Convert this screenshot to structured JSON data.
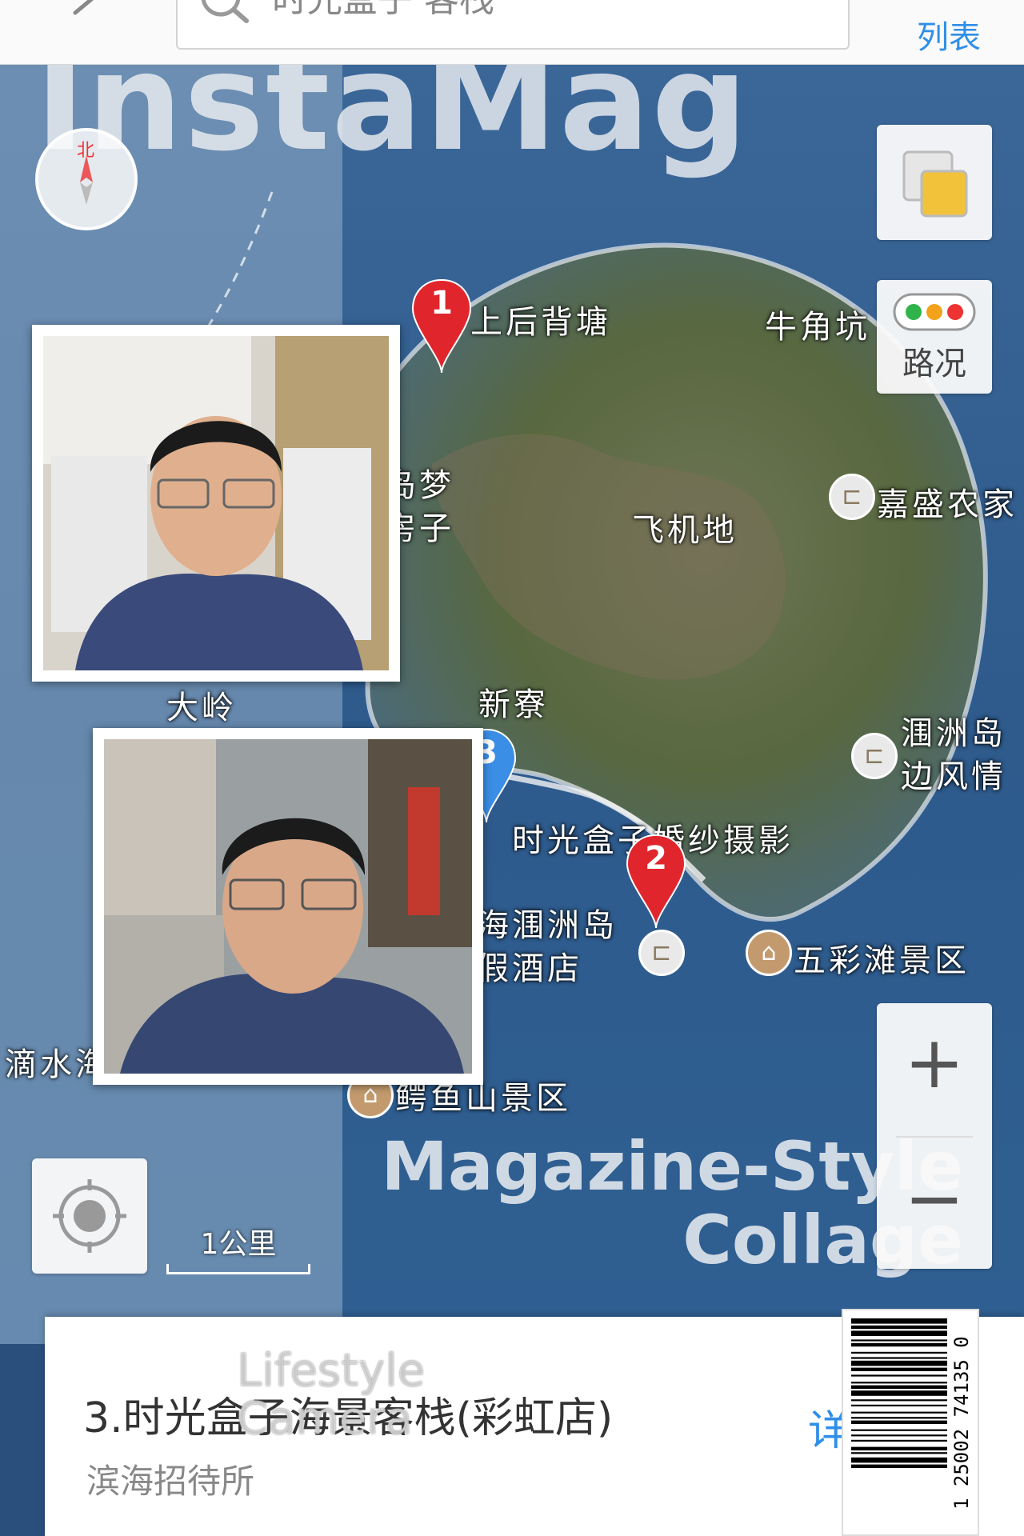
{
  "header": {
    "search_query": "时光盒子 客栈",
    "list_label": "列表"
  },
  "controls": {
    "compass_north": "北",
    "traffic_label": "路况",
    "scale_label": "1公里",
    "zoom_in": "+",
    "zoom_out": "−"
  },
  "map": {
    "labels": {
      "shanghoubeitang": "上后背塘",
      "niujiaokeng": "牛角坑",
      "jiasheng": "嘉盛农家",
      "daomeng": "岛梦\n房子",
      "feijidi": "飞机地",
      "daling": "大岭",
      "xinliao": "新寮",
      "weizhou_fengqing": "涠洲岛\n边风情",
      "shiguang_hesha": "时光盒子婚纱摄影",
      "haiweizhou": "海涠洲岛\n假酒店",
      "wucaitan": "五彩滩景区",
      "dishui": "滴水海景酒店",
      "eyushan": "鳄鱼山景区"
    },
    "pins": [
      {
        "num": "1",
        "color": "#e0262c"
      },
      {
        "num": "2",
        "color": "#e0262c"
      },
      {
        "num": "3",
        "color": "#3a8ee6"
      }
    ]
  },
  "watermarks": {
    "brand": "InstaMag",
    "magazine_line1": "Magazine-Style",
    "magazine_line2": "Collage",
    "lifestyle_line1": "Lifestyle",
    "lifestyle_line2": "Camera"
  },
  "info_card": {
    "title": "3.时光盒子海景客栈(彩虹店)",
    "subtitle": "滨海招待所",
    "detail": "详"
  },
  "barcode": {
    "number": "1 25002 74135 0"
  }
}
